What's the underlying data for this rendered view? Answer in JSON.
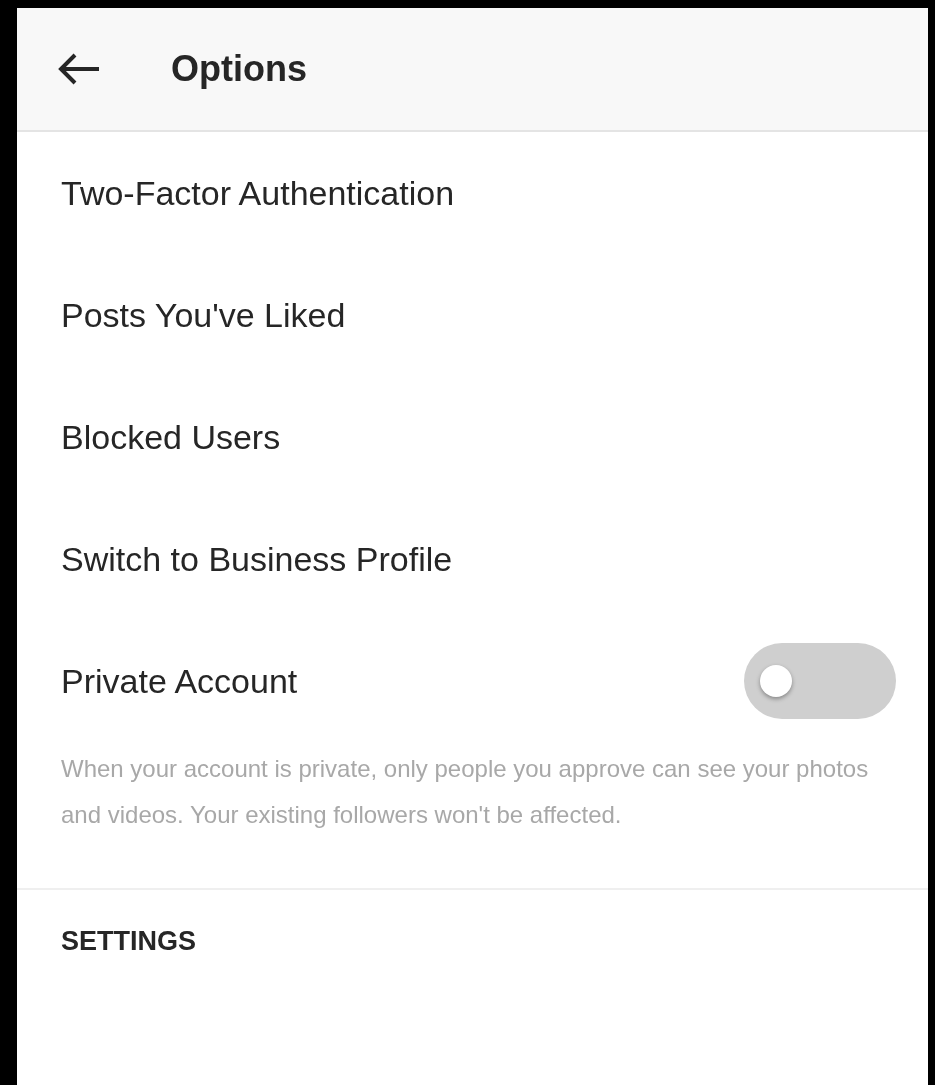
{
  "header": {
    "title": "Options"
  },
  "items": [
    {
      "kind": "link",
      "label": "Two-Factor Authentication"
    },
    {
      "kind": "link",
      "label": "Posts You've Liked"
    },
    {
      "kind": "link",
      "label": "Blocked Users"
    },
    {
      "kind": "link",
      "label": "Switch to Business Profile"
    },
    {
      "kind": "toggle",
      "label": "Private Account",
      "on": false,
      "description": "When your account is private, only people you approve can see your photos and videos. Your existing followers won't be affected."
    }
  ],
  "section": {
    "title": "SETTINGS"
  }
}
